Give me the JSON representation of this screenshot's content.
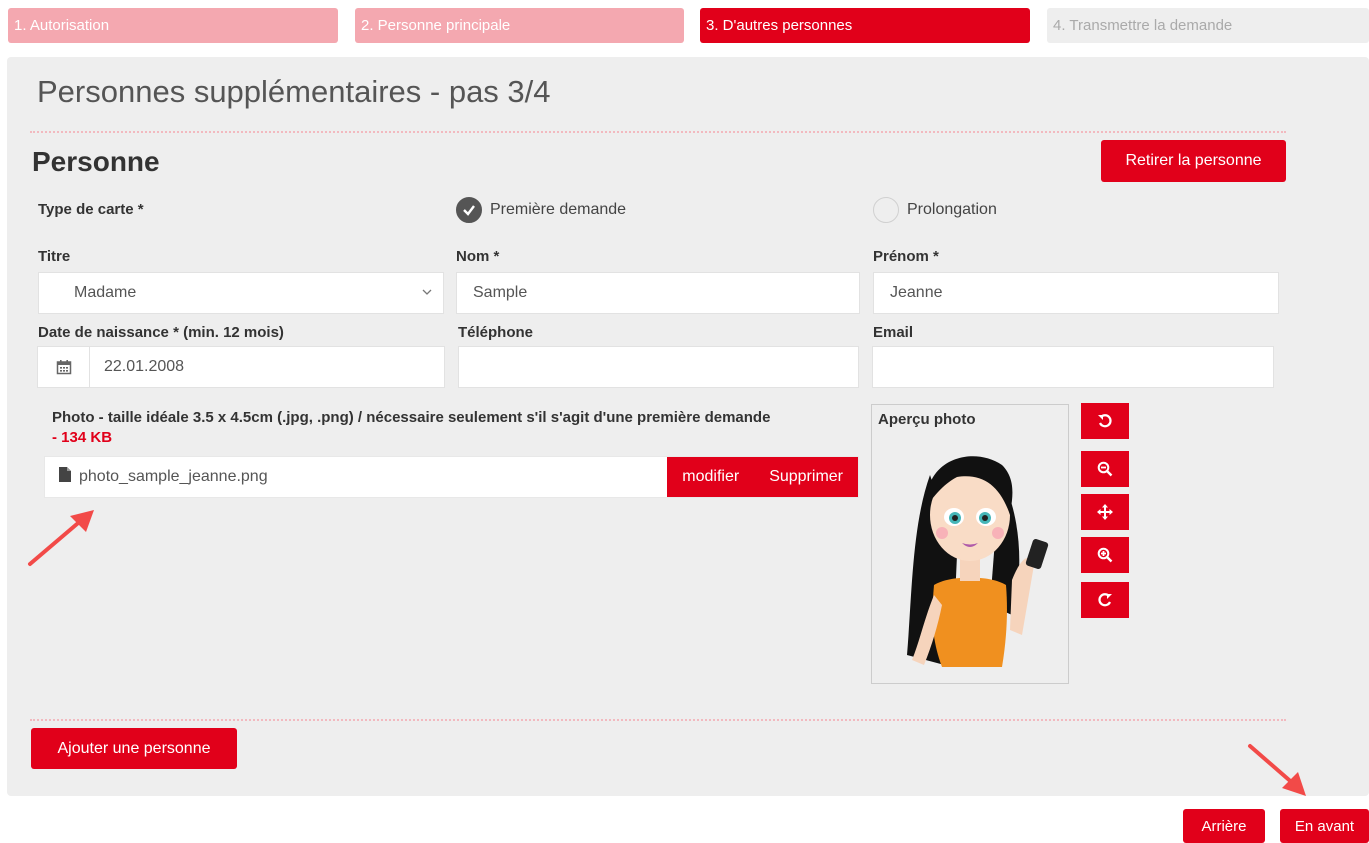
{
  "steps": [
    {
      "label": "1. Autorisation",
      "state": "done"
    },
    {
      "label": "2. Personne principale",
      "state": "done"
    },
    {
      "label": "3. D'autres personnes",
      "state": "active"
    },
    {
      "label": "4. Transmettre la demande",
      "state": "todo"
    }
  ],
  "page": {
    "title": "Personnes supplémentaires - pas 3/4"
  },
  "person": {
    "section_title": "Personne",
    "remove_label": "Retirer la personne",
    "card_type_label": "Type de carte *",
    "card_options": [
      {
        "label": "Première demande",
        "checked": true
      },
      {
        "label": "Prolongation",
        "checked": false
      }
    ],
    "title_label": "Titre",
    "title_value": "Madame",
    "lastname_label": "Nom *",
    "lastname_value": "Sample",
    "firstname_label": "Prénom *",
    "firstname_value": "Jeanne",
    "birthdate_label": "Date de naissance * (min. 12 mois)",
    "birthdate_value": "22.01.2008",
    "phone_label": "Téléphone",
    "phone_value": "",
    "email_label": "Email",
    "email_value": "",
    "photo_label": "Photo - taille idéale 3.5 x 4.5cm (.jpg, .png) / nécessaire seulement s'il s'agit d'une première demande",
    "photo_size": "- 134 KB",
    "photo_filename": "photo_sample_jeanne.png",
    "modify_label": "modifier",
    "delete_label": "Supprimer",
    "preview_label": "Aperçu photo"
  },
  "add_person_label": "Ajouter une personne",
  "nav": {
    "back_label": "Arrière",
    "next_label": "En avant"
  },
  "colors": {
    "accent": "#e1001a",
    "step_done": "#f4a8b0",
    "panel": "#eeeeee"
  }
}
